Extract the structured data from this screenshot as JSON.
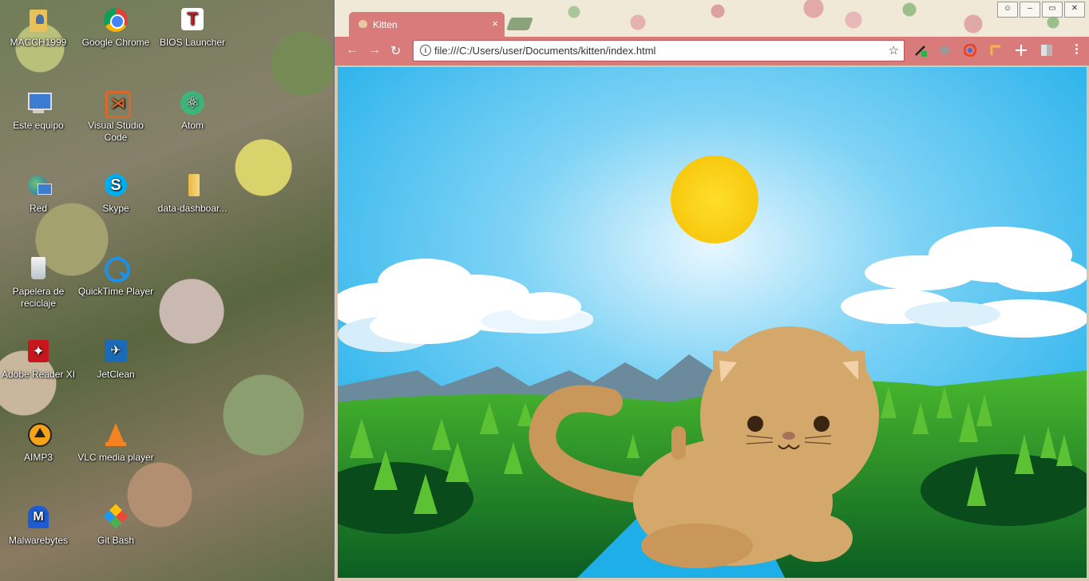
{
  "desktop": {
    "icons": [
      {
        "label": "MACCH1999",
        "icon": "user-folder-icon"
      },
      {
        "label": "Google Chrome",
        "icon": "chrome-icon"
      },
      {
        "label": "BIOS Launcher",
        "icon": "bios-launcher-icon"
      },
      {
        "label": "Este equipo",
        "icon": "computer-icon"
      },
      {
        "label": "Visual Studio Code",
        "icon": "vscode-icon"
      },
      {
        "label": "Atom",
        "icon": "atom-icon"
      },
      {
        "label": "Red",
        "icon": "network-icon"
      },
      {
        "label": "Skype",
        "icon": "skype-icon"
      },
      {
        "label": "data-dashboar...",
        "icon": "folder-icon"
      },
      {
        "label": "Papelera de reciclaje",
        "icon": "recycle-bin-icon"
      },
      {
        "label": "QuickTime Player",
        "icon": "quicktime-icon"
      },
      {
        "label": "Adobe Reader XI",
        "icon": "adobe-reader-icon"
      },
      {
        "label": "JetClean",
        "icon": "jetclean-icon"
      },
      {
        "label": "AIMP3",
        "icon": "aimp-icon"
      },
      {
        "label": "VLC media player",
        "icon": "vlc-icon"
      },
      {
        "label": "Malwarebytes",
        "icon": "malwarebytes-icon"
      },
      {
        "label": "Git Bash",
        "icon": "git-bash-icon"
      }
    ]
  },
  "browser": {
    "tab_title": "Kitten",
    "tab_close": "×",
    "url": "file:///C:/Users/user/Documents/kitten/index.html",
    "theme_color": "#d97b7b"
  },
  "page": {
    "sky_color": "#1fb6ec",
    "sun_color": "#f9d315",
    "cat_color": "#d4a86b"
  }
}
